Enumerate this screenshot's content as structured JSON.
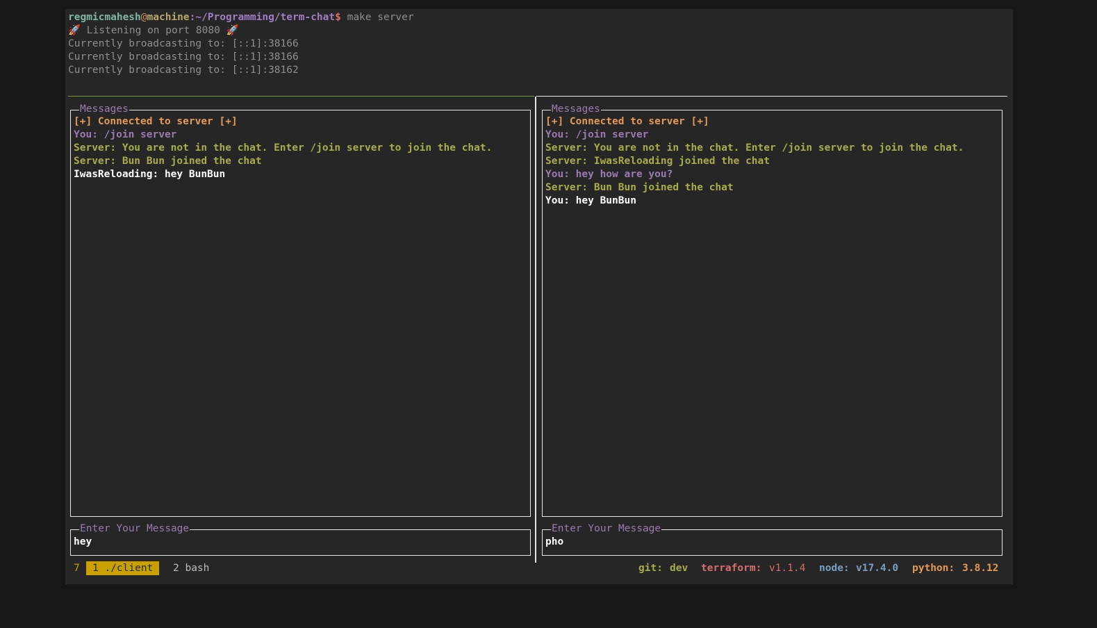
{
  "terminal": {
    "prompt": {
      "user": "regmicmahesh",
      "at": "@",
      "host": "machine",
      "path": ":~/Programming/term-chat",
      "dollar": "$",
      "command": " make server"
    },
    "output": [
      "🚀 Listening on port 8080 🚀",
      "Currently broadcasting to: [::1]:38166",
      "Currently broadcasting to: [::1]:38166",
      "Currently broadcasting to: [::1]:38162"
    ]
  },
  "left_pane": {
    "messages_title": "Messages",
    "messages": [
      {
        "text": "[+] Connected to server [+]"
      },
      {
        "text": "You: /join server"
      },
      {
        "text": "Server: You are not in the chat. Enter /join server to join the chat."
      },
      {
        "text": "Server: Bun Bun joined the chat"
      },
      {
        "text": "IwasReloading: hey BunBun"
      }
    ],
    "input_title": "Enter Your Message",
    "input_value": "hey"
  },
  "right_pane": {
    "messages_title": "Messages",
    "messages": [
      {
        "text": "[+] Connected to server [+]"
      },
      {
        "text": "You: /join server"
      },
      {
        "text": "Server: You are not in the chat. Enter /join server to join the chat."
      },
      {
        "text": "Server: IwasReloading joined the chat"
      },
      {
        "text": "You: hey how are you?"
      },
      {
        "text": "Server: Bun Bun joined the chat"
      },
      {
        "text": "You: hey BunBun"
      }
    ],
    "input_title": "Enter Your Message",
    "input_value": "pho"
  },
  "status_bar": {
    "session": "7",
    "active_window": "1 ./client",
    "other_window": "2 bash",
    "git_label": "git:",
    "git_value": "dev",
    "terraform_label": "terraform:",
    "terraform_value": "v1.1.4",
    "node_label": "node:",
    "node_value": "v17.4.0",
    "python_label": "python:",
    "python_value": "3.8.12"
  },
  "colors": {
    "background": "#262626",
    "status_olive": "#a8ad4a",
    "terraform_red": "#d86e6e",
    "node_blue": "#7a9ec0",
    "python_orange": "#e59a55",
    "active_window": "#c8a000"
  }
}
